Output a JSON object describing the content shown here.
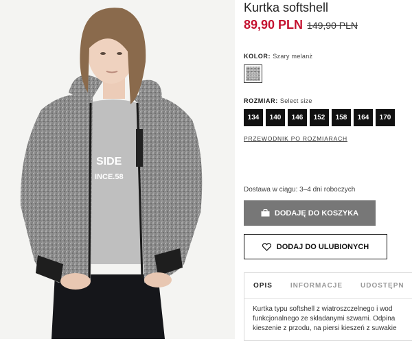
{
  "product": {
    "title": "Kurtka softshell",
    "price": "89,90 PLN",
    "old_price": "149,90 PLN"
  },
  "color": {
    "label": "KOLOR:",
    "value": "Szary melanż"
  },
  "size": {
    "label": "ROZMIAR:",
    "value": "Select size",
    "options": [
      "134",
      "140",
      "146",
      "152",
      "158",
      "164",
      "170"
    ],
    "guide_link": "PRZEWODNIK PO ROZMIARACH"
  },
  "delivery": "Dostawa w ciągu: 3–4 dni roboczych",
  "buttons": {
    "add_to_cart": "DODAJĘ DO KOSZYKA",
    "add_to_favorites": "DODAJ DO ULUBIONYCH"
  },
  "tabs": [
    "OPIS",
    "INFORMACJE",
    "UDOSTĘPN"
  ],
  "description_lines": [
    "Kurtka typu softshell z wiatroszczelnego i wod",
    "funkcjonalnego ze składanymi szwami. Odpina",
    "kieszenie z przodu, na piersi kieszeń z suwakie"
  ],
  "photo": {
    "shirt_text_1": "SIDE",
    "shirt_text_2": "INCE.58"
  },
  "colors": {
    "price_red": "#c41230",
    "button_gray": "#777777",
    "size_black": "#111111"
  }
}
